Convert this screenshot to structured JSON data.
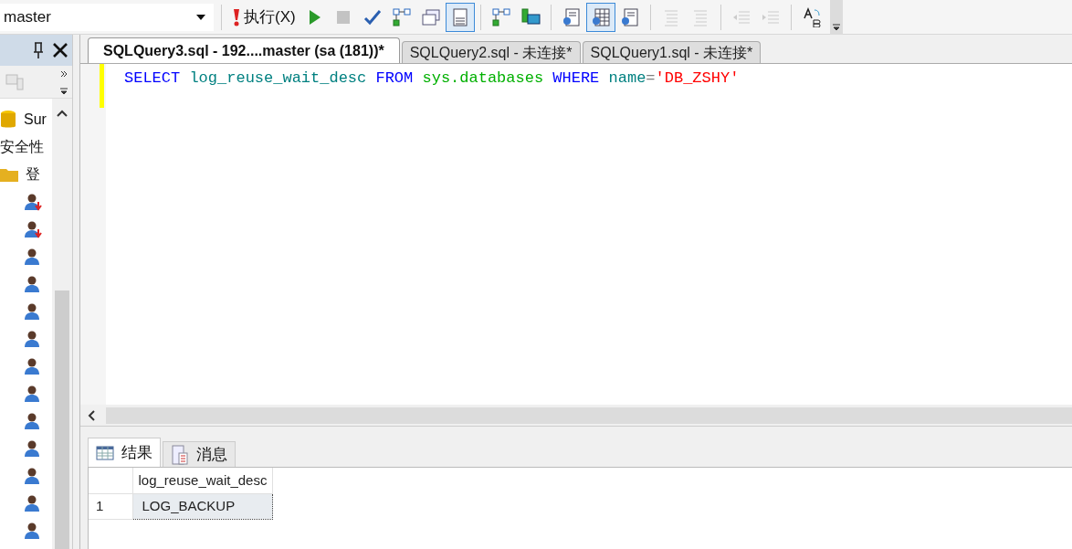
{
  "toolbar": {
    "database": "master",
    "execute_label": "执行(X)",
    "buttons": [
      {
        "kind": "play",
        "active": false,
        "disabled": false
      },
      {
        "kind": "stop",
        "active": false,
        "disabled": true
      },
      {
        "kind": "check",
        "active": false,
        "disabled": false
      },
      {
        "kind": "plan",
        "active": false,
        "disabled": false
      },
      {
        "kind": "windows",
        "active": false,
        "disabled": false
      },
      {
        "kind": "form",
        "active": true,
        "disabled": false
      },
      {
        "kind": "sep"
      },
      {
        "kind": "plan",
        "active": false,
        "disabled": false
      },
      {
        "kind": "monitor",
        "active": false,
        "disabled": false
      },
      {
        "kind": "sep"
      },
      {
        "kind": "doc",
        "active": false,
        "disabled": false
      },
      {
        "kind": "grid",
        "active": true,
        "disabled": false
      },
      {
        "kind": "doc",
        "active": false,
        "disabled": false
      },
      {
        "kind": "sep"
      },
      {
        "kind": "lines",
        "active": false,
        "disabled": true
      },
      {
        "kind": "lines",
        "active": false,
        "disabled": true
      },
      {
        "kind": "sep"
      },
      {
        "kind": "outdent",
        "active": false,
        "disabled": true
      },
      {
        "kind": "indent",
        "active": false,
        "disabled": true
      },
      {
        "kind": "sep"
      },
      {
        "kind": "replace",
        "active": false,
        "disabled": false
      }
    ]
  },
  "object_explorer": {
    "items": [
      {
        "kind": "database",
        "label": "Sur"
      },
      {
        "kind": "text",
        "label": "安全性"
      },
      {
        "kind": "folder",
        "label": "登"
      },
      {
        "kind": "login-denied"
      },
      {
        "kind": "login-denied"
      },
      {
        "kind": "login"
      },
      {
        "kind": "login"
      },
      {
        "kind": "login"
      },
      {
        "kind": "login"
      },
      {
        "kind": "login"
      },
      {
        "kind": "login"
      },
      {
        "kind": "login"
      },
      {
        "kind": "login"
      },
      {
        "kind": "login"
      },
      {
        "kind": "login"
      },
      {
        "kind": "login"
      }
    ]
  },
  "tabs": [
    {
      "label": "SQLQuery3.sql - 192....master (sa (181))*",
      "selected": true
    },
    {
      "label": "SQLQuery2.sql - 未连接*",
      "selected": false
    },
    {
      "label": "SQLQuery1.sql - 未连接*",
      "selected": false
    }
  ],
  "editor": {
    "tokens": [
      {
        "kind": "keyword",
        "text": "SELECT"
      },
      {
        "kind": "identifier",
        "text": "log_reuse_wait_desc"
      },
      {
        "kind": "keyword",
        "text": "FROM"
      },
      {
        "kind": "system",
        "text": "sys.databases"
      },
      {
        "kind": "keyword",
        "text": "WHERE"
      },
      {
        "kind": "identifier",
        "text": "name"
      },
      {
        "kind": "operator",
        "text": "="
      },
      {
        "kind": "string",
        "text": "'DB_ZSHY'"
      }
    ]
  },
  "results": {
    "tabs": [
      {
        "label": "结果",
        "kind": "grid",
        "selected": true
      },
      {
        "label": "消息",
        "kind": "messages",
        "selected": false
      }
    ],
    "columns": [
      "log_reuse_wait_desc"
    ],
    "rows": [
      {
        "number": "1",
        "cells": [
          "LOG_BACKUP"
        ]
      }
    ]
  }
}
